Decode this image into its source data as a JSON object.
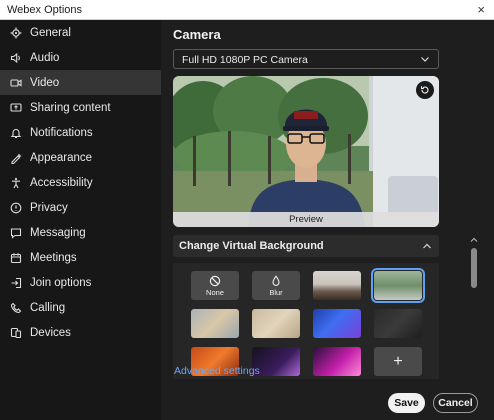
{
  "window": {
    "title": "Webex Options",
    "close_glyph": "×"
  },
  "sidebar": {
    "items": [
      {
        "label": "General",
        "icon": "gear-icon"
      },
      {
        "label": "Audio",
        "icon": "audio-icon"
      },
      {
        "label": "Video",
        "icon": "video-camera-icon",
        "active": true
      },
      {
        "label": "Sharing content",
        "icon": "share-screen-icon"
      },
      {
        "label": "Notifications",
        "icon": "bell-icon"
      },
      {
        "label": "Appearance",
        "icon": "appearance-icon"
      },
      {
        "label": "Accessibility",
        "icon": "accessibility-icon"
      },
      {
        "label": "Privacy",
        "icon": "privacy-icon"
      },
      {
        "label": "Messaging",
        "icon": "message-icon"
      },
      {
        "label": "Meetings",
        "icon": "calendar-icon"
      },
      {
        "label": "Join options",
        "icon": "join-options-icon"
      },
      {
        "label": "Calling",
        "icon": "phone-icon"
      },
      {
        "label": "Devices",
        "icon": "devices-icon"
      }
    ]
  },
  "main": {
    "section_title": "Camera",
    "camera_select": {
      "value": "Full HD 1080P PC Camera"
    },
    "preview": {
      "label": "Preview",
      "rotate_icon": "rotate-camera-icon"
    },
    "virtual_background": {
      "header": "Change Virtual Background",
      "none_label": "None",
      "blur_label": "Blur",
      "add_glyph": "+"
    },
    "advanced_link": "Advanced settings"
  },
  "footer": {
    "save_label": "Save",
    "cancel_label": "Cancel"
  },
  "colors": {
    "accent": "#6aa7f2",
    "selected_outline": "#5ea0f5",
    "sidebar_bg": "#171717",
    "content_bg": "#1e1e1e"
  }
}
